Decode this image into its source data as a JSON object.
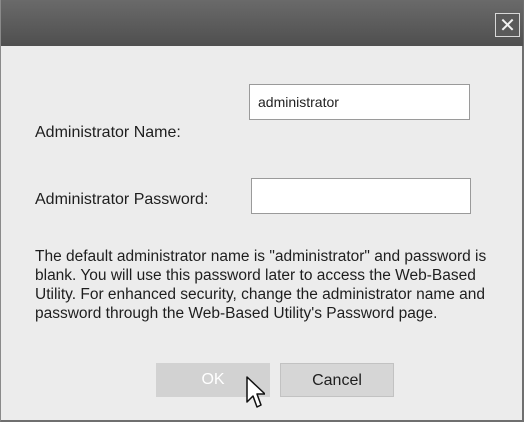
{
  "dialog": {
    "close_glyph": "✕",
    "name_label": "Administrator Name:",
    "name_value": "administrator",
    "password_label": "Administrator Password:",
    "password_value": "",
    "info_text": "The default administrator name is \"administrator\" and password is blank. You will use this password later to access the Web-Based Utility. For enhanced security, change the administrator name and password through the Web-Based Utility's Password page.",
    "ok_label": "OK",
    "cancel_label": "Cancel"
  },
  "icons": {
    "close": "close-icon",
    "cursor": "mouse-pointer-icon"
  },
  "colors": {
    "titlebar": "#5a5a5a",
    "dialog_bg": "#ececec",
    "button_bg": "#d6d6d6"
  }
}
